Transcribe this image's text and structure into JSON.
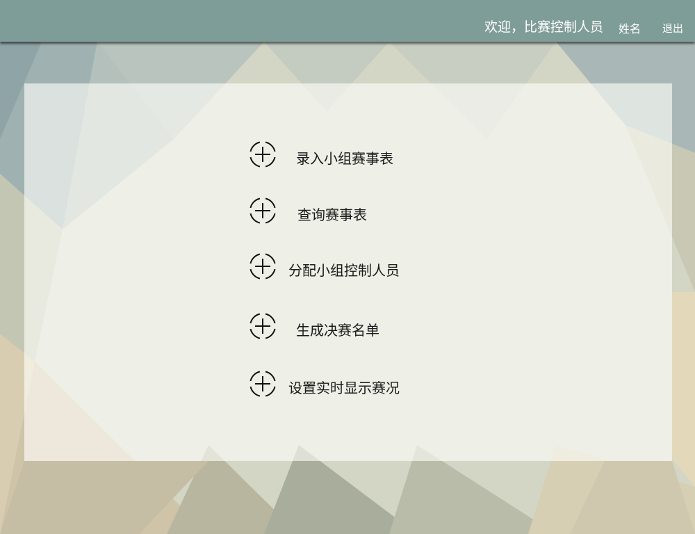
{
  "header": {
    "welcome_text": "欢迎，比赛控制人员",
    "username": "姓名",
    "logout_label": "退出"
  },
  "menu": {
    "items": [
      {
        "label": "录入小组赛事表",
        "icon": "plus-circle-icon"
      },
      {
        "label": "查询赛事表",
        "icon": "plus-circle-icon"
      },
      {
        "label": "分配小组控制人员",
        "icon": "plus-circle-icon"
      },
      {
        "label": "生成决赛名单",
        "icon": "plus-circle-icon"
      },
      {
        "label": "设置实时显示赛况",
        "icon": "plus-circle-icon"
      }
    ]
  },
  "colors": {
    "header_bg": "#7f9d98",
    "text_dark": "#1a1a1a",
    "header_text": "#ffffff"
  }
}
